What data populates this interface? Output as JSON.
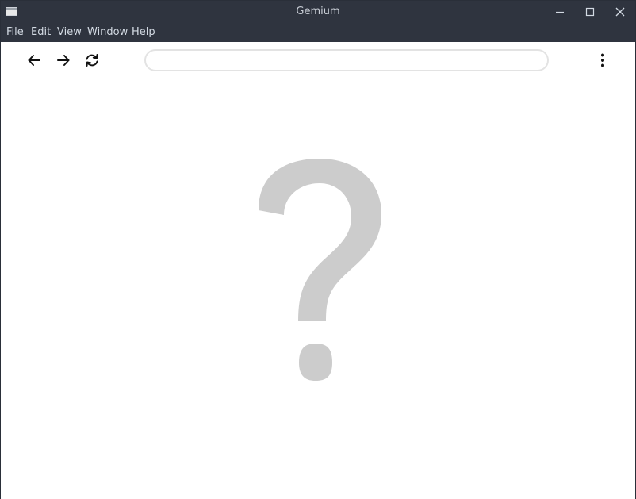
{
  "window": {
    "title": "Gemium"
  },
  "menubar": {
    "items": [
      {
        "label": "File"
      },
      {
        "label": "Edit"
      },
      {
        "label": "View"
      },
      {
        "label": "Window"
      },
      {
        "label": "Help"
      }
    ]
  },
  "toolbar": {
    "back_icon": "arrow-left-icon",
    "forward_icon": "arrow-right-icon",
    "reload_icon": "reload-icon",
    "menu_icon": "kebab-menu-icon"
  },
  "address_bar": {
    "value": "",
    "placeholder": ""
  },
  "content": {
    "placeholder_icon": "question-mark-icon"
  },
  "colors": {
    "titlebar": "#2f343f",
    "placeholder_glyph": "#cccccc"
  }
}
